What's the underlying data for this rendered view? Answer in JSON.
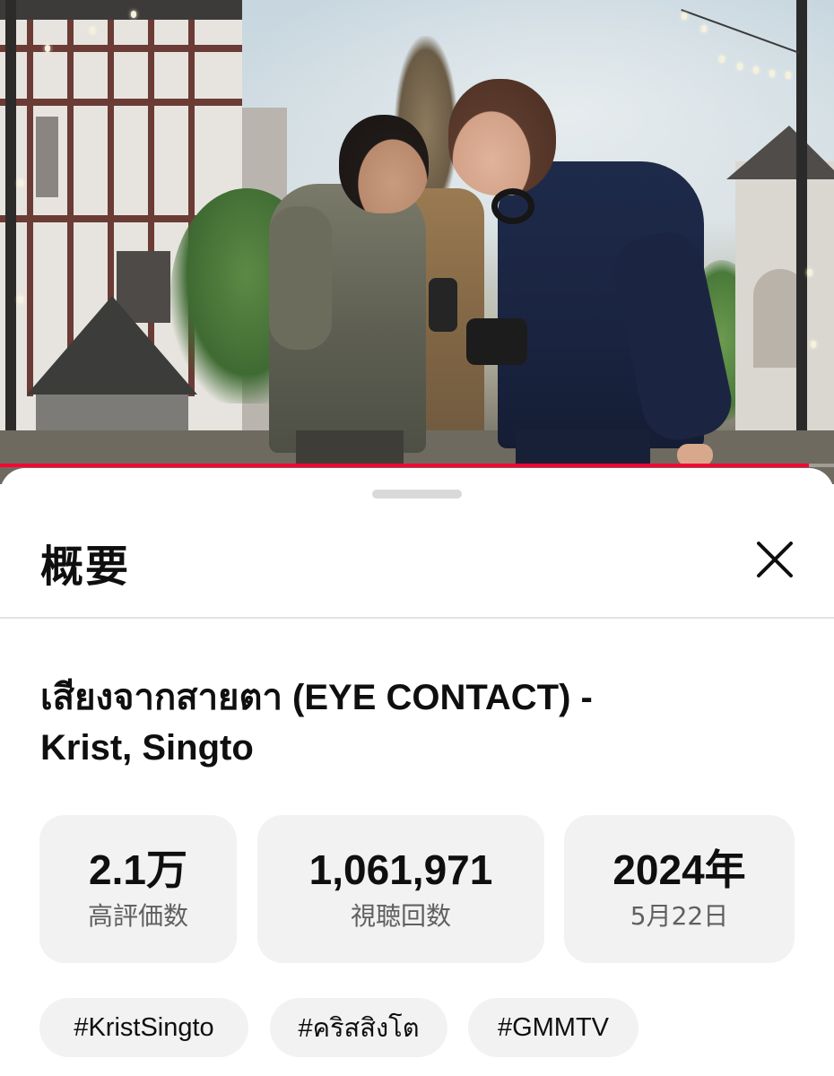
{
  "player": {
    "progress_fraction": 0.97,
    "progress_color": "#ff0033"
  },
  "description_panel": {
    "heading": "概要",
    "close_icon": "close-icon",
    "video_title_line1": "เสียงจากสายตา (EYE CONTACT) -",
    "video_title_line2": "Krist, Singto",
    "stats": {
      "likes_value": "2.1万",
      "likes_label": "高評価数",
      "views_value": "1,061,971",
      "views_label": "視聴回数",
      "date_year": "2024年",
      "date_day": "5月22日"
    },
    "hashtags": [
      "#KristSingto",
      "#คริสสิงโต",
      "#GMMTV"
    ]
  },
  "colors": {
    "accent_red": "#ff0033",
    "chip_background": "#f2f2f2",
    "secondary_text": "#606060"
  }
}
